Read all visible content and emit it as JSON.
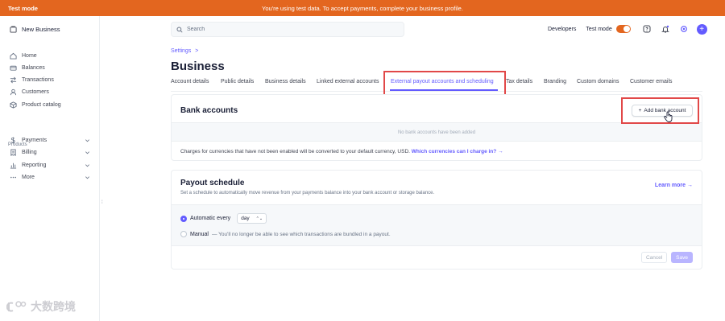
{
  "banner": {
    "mode": "Test mode",
    "message": "You're using test data. To accept payments, complete your business profile."
  },
  "sidebar": {
    "account": "New Business",
    "items": [
      {
        "label": "Home",
        "icon": "home-icon"
      },
      {
        "label": "Balances",
        "icon": "balance-icon"
      },
      {
        "label": "Transactions",
        "icon": "transactions-icon"
      },
      {
        "label": "Customers",
        "icon": "customers-icon"
      },
      {
        "label": "Product catalog",
        "icon": "product-icon"
      }
    ],
    "section_label": "Products",
    "product_items": [
      {
        "label": "Payments",
        "icon": "payments-icon"
      },
      {
        "label": "Billing",
        "icon": "billing-icon"
      },
      {
        "label": "Reporting",
        "icon": "reporting-icon"
      },
      {
        "label": "More",
        "icon": "more-icon"
      }
    ]
  },
  "topbar": {
    "search_placeholder": "Search",
    "developers": "Developers",
    "test_mode": "Test mode",
    "test_mode_on": true
  },
  "page": {
    "breadcrumb": "Settings",
    "breadcrumb_sep": ">",
    "title": "Business",
    "tabs": [
      "Account details",
      "Public details",
      "Business details",
      "Linked external accounts",
      "External payout accounts and scheduling",
      "Tax details",
      "Branding",
      "Custom domains",
      "Customer emails"
    ],
    "active_tab": "External payout accounts and scheduling"
  },
  "bank_accounts": {
    "title": "Bank accounts",
    "add_button": "Add bank account",
    "empty": "No bank accounts have been added",
    "note": "Charges for currencies that have not been enabled will be converted to your default currency, USD.",
    "note_link": "Which currencies can I charge in?"
  },
  "payout_schedule": {
    "title": "Payout schedule",
    "description": "Set a schedule to automatically move revenue from your payments balance into your bank account or storage balance.",
    "learn_more": "Learn more",
    "automatic_label": "Automatic every",
    "interval": "day",
    "manual_label": "Manual",
    "manual_note": "— You'll no longer be able to see which transactions are bundled in a payout.",
    "cancel": "Cancel",
    "save": "Save"
  },
  "watermark": "大数跨境",
  "colors": {
    "banner": "#e3661f",
    "accent": "#635bff",
    "highlight": "#e14848"
  }
}
